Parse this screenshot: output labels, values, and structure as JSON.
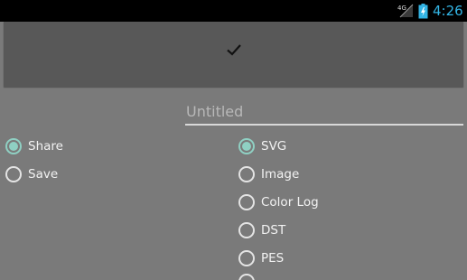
{
  "status_bar": {
    "network": "4G",
    "network_icon": "signal-icon",
    "battery_icon": "battery-charging-icon",
    "time": "4:26",
    "time_color": "#33b5e5"
  },
  "done_bar": {
    "icon": "check-icon"
  },
  "filename_field": {
    "placeholder": "Untitled",
    "value": ""
  },
  "action_group": {
    "options": [
      {
        "label": "Share",
        "checked": true
      },
      {
        "label": "Save",
        "checked": false
      }
    ]
  },
  "format_group": {
    "options": [
      {
        "label": "SVG",
        "checked": true
      },
      {
        "label": "Image",
        "checked": false
      },
      {
        "label": "Color Log",
        "checked": false
      },
      {
        "label": "DST",
        "checked": false
      },
      {
        "label": "PES",
        "checked": false
      }
    ]
  },
  "colors": {
    "accent": "#8fd0c3",
    "background": "#7a7a7a",
    "done_bar": "#585858"
  }
}
